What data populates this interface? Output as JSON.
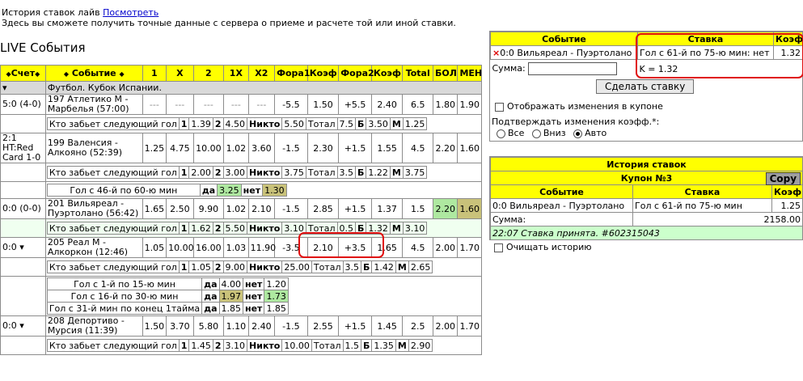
{
  "top": {
    "history_text": "История ставок лайв",
    "history_link": "Посмотреть",
    "info_text": "Здесь вы сможете получить точные данные с сервера о приеме и расчете той или иной ставки."
  },
  "live_title": "LIVE События",
  "headers": {
    "score": "Счет",
    "event": "Событие",
    "c1": "1",
    "cx": "X",
    "c2": "2",
    "c1x": "1X",
    "cx2": "X2",
    "fora1": "Фора1",
    "koef1": "Коэф",
    "fora2": "Фора2",
    "koef2": "Коэф",
    "total": "Total",
    "bol": "БОЛ",
    "men": "МЕН"
  },
  "category": "Футбол. Кубок Испании.",
  "labels": {
    "next_goal": "Кто забьет следующий гол",
    "nikto": "Никто",
    "total_word": "Тотал",
    "b": "Б",
    "m": "М",
    "da": "да",
    "net": "нет",
    "one": "1",
    "two": "2"
  },
  "events": [
    {
      "score": "5:0 (4-0)",
      "name": "197 Атлетико М - Марбелья (57:00)",
      "odds": [
        "---",
        "---",
        "---",
        "---",
        "---",
        "-5.5",
        "1.50",
        "+5.5",
        "2.40",
        "6.5",
        "1.80",
        "1.90"
      ],
      "ng": {
        "p1": "1.39",
        "p2": "4.50",
        "nikto": "5.50",
        "total": "7.5",
        "b": "3.50",
        "m": "1.25"
      }
    },
    {
      "score": "2:1 HT:Red Card 1-0",
      "name": "199 Валенсия - Алкояно (52:39)",
      "odds": [
        "1.25",
        "4.75",
        "10.00",
        "1.02",
        "3.60",
        "-1.5",
        "2.30",
        "+1.5",
        "1.55",
        "4.5",
        "2.20",
        "1.60"
      ],
      "ng": {
        "p1": "2.00",
        "p2": "3.00",
        "nikto": "3.75",
        "total": "3.5",
        "b": "1.22",
        "m": "3.75"
      },
      "extra": [
        {
          "label": "Гол с 46-й по 60-ю мин",
          "da": "3.25",
          "net": "1.30"
        }
      ]
    },
    {
      "score": "0:0 (0-0)",
      "name": "201 Вильяреал - Пуэртолано (56:42)",
      "odds": [
        "1.65",
        "2.50",
        "9.90",
        "1.02",
        "2.10",
        "-1.5",
        "2.85",
        "+1.5",
        "1.37",
        "1.5",
        "2.20",
        "1.60"
      ],
      "ng": {
        "p1": "1.62",
        "p2": "5.50",
        "nikto": "3.10",
        "total": "0.5",
        "b": "1.32",
        "m": "3.10"
      }
    },
    {
      "score": "0:0",
      "name": "205 Реал М - Алкоркон (12:46)",
      "odds": [
        "1.05",
        "10.00",
        "16.00",
        "1.03",
        "11.90",
        "-3.5",
        "2.10",
        "+3.5",
        "1.65",
        "4.5",
        "2.00",
        "1.70"
      ],
      "ng": {
        "p1": "1.05",
        "p2": "9.00",
        "nikto": "25.00",
        "total": "3.5",
        "b": "1.42",
        "m": "2.65"
      },
      "extra": [
        {
          "label": "Гол с 1-й по 15-ю мин",
          "da": "4.00",
          "net": "1.20"
        },
        {
          "label": "Гол с 16-й по 30-ю мин",
          "da": "1.97",
          "net": "1.73"
        },
        {
          "label": "Гол с 31-й мин по конец 1тайма",
          "da": "1.85",
          "net": "1.85"
        }
      ]
    },
    {
      "score": "0:0",
      "name": "208 Депортиво - Мурсия (11:39)",
      "odds": [
        "1.50",
        "3.70",
        "5.80",
        "1.10",
        "2.40",
        "-1.5",
        "2.55",
        "+1.5",
        "1.45",
        "2.5",
        "2.00",
        "1.70"
      ],
      "ng": {
        "p1": "1.45",
        "p2": "3.10",
        "nikto": "10.00",
        "total": "1.5",
        "b": "1.35",
        "m": "2.90"
      }
    }
  ],
  "coupon": {
    "col_event": "Событие",
    "col_stake": "Ставка",
    "col_koef": "Коэф",
    "remove": "×",
    "event": "0:0 Вильяреал - Пуэртолано",
    "stake": "Гол с 61-й по 75-ю мин: нет",
    "koef": "1.32",
    "k_text": "K = 1.32",
    "sum_label": "Сумма:",
    "sum_value": "",
    "place_button": "Сделать ставку",
    "show_changes": "Отображать изменения в купоне",
    "confirm_label": "Подтверждать изменения коэфф.*:",
    "opt_all": "Все",
    "opt_down": "Вниз",
    "opt_auto": "Авто"
  },
  "history": {
    "title": "История ставок",
    "coupon_title": "Купон №3",
    "copy_button": "Copy",
    "col_event": "Событие",
    "col_stake": "Ставка",
    "col_koef": "Коэф",
    "event": "0:0 Вильяреал - Пуэртолано",
    "stake": "Гол с 61-й по 75-ю мин",
    "koef": "1.25",
    "sum_label": "Сумма:",
    "sum_value": "2158.00",
    "status": "22:07 Ставка принята. #602315043",
    "clear_label": "Очищать историю"
  }
}
